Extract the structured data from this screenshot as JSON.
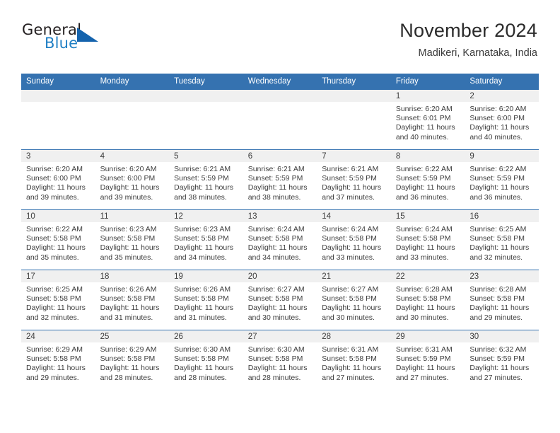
{
  "brand": {
    "name_part1": "General",
    "name_part2": "Blue",
    "triangle_color": "#1463ad",
    "blue_color": "#1f7fc4"
  },
  "header": {
    "title": "November 2024",
    "subtitle": "Madikeri, Karnataka, India"
  },
  "theme": {
    "header_blue": "#3572b0",
    "daynum_band": "#f0f0f0",
    "text": "#3c3c3c"
  },
  "weekdays": [
    "Sunday",
    "Monday",
    "Tuesday",
    "Wednesday",
    "Thursday",
    "Friday",
    "Saturday"
  ],
  "labels": {
    "sunrise_prefix": "Sunrise:",
    "sunset_prefix": "Sunset:",
    "daylight_prefix": "Daylight:"
  },
  "weeks": [
    [
      {
        "empty": true
      },
      {
        "empty": true
      },
      {
        "empty": true
      },
      {
        "empty": true
      },
      {
        "empty": true
      },
      {
        "day": "1",
        "sunrise": "Sunrise: 6:20 AM",
        "sunset": "Sunset: 6:01 PM",
        "daylight": "Daylight: 11 hours and 40 minutes."
      },
      {
        "day": "2",
        "sunrise": "Sunrise: 6:20 AM",
        "sunset": "Sunset: 6:00 PM",
        "daylight": "Daylight: 11 hours and 40 minutes."
      }
    ],
    [
      {
        "day": "3",
        "sunrise": "Sunrise: 6:20 AM",
        "sunset": "Sunset: 6:00 PM",
        "daylight": "Daylight: 11 hours and 39 minutes."
      },
      {
        "day": "4",
        "sunrise": "Sunrise: 6:20 AM",
        "sunset": "Sunset: 6:00 PM",
        "daylight": "Daylight: 11 hours and 39 minutes."
      },
      {
        "day": "5",
        "sunrise": "Sunrise: 6:21 AM",
        "sunset": "Sunset: 5:59 PM",
        "daylight": "Daylight: 11 hours and 38 minutes."
      },
      {
        "day": "6",
        "sunrise": "Sunrise: 6:21 AM",
        "sunset": "Sunset: 5:59 PM",
        "daylight": "Daylight: 11 hours and 38 minutes."
      },
      {
        "day": "7",
        "sunrise": "Sunrise: 6:21 AM",
        "sunset": "Sunset: 5:59 PM",
        "daylight": "Daylight: 11 hours and 37 minutes."
      },
      {
        "day": "8",
        "sunrise": "Sunrise: 6:22 AM",
        "sunset": "Sunset: 5:59 PM",
        "daylight": "Daylight: 11 hours and 36 minutes."
      },
      {
        "day": "9",
        "sunrise": "Sunrise: 6:22 AM",
        "sunset": "Sunset: 5:59 PM",
        "daylight": "Daylight: 11 hours and 36 minutes."
      }
    ],
    [
      {
        "day": "10",
        "sunrise": "Sunrise: 6:22 AM",
        "sunset": "Sunset: 5:58 PM",
        "daylight": "Daylight: 11 hours and 35 minutes."
      },
      {
        "day": "11",
        "sunrise": "Sunrise: 6:23 AM",
        "sunset": "Sunset: 5:58 PM",
        "daylight": "Daylight: 11 hours and 35 minutes."
      },
      {
        "day": "12",
        "sunrise": "Sunrise: 6:23 AM",
        "sunset": "Sunset: 5:58 PM",
        "daylight": "Daylight: 11 hours and 34 minutes."
      },
      {
        "day": "13",
        "sunrise": "Sunrise: 6:24 AM",
        "sunset": "Sunset: 5:58 PM",
        "daylight": "Daylight: 11 hours and 34 minutes."
      },
      {
        "day": "14",
        "sunrise": "Sunrise: 6:24 AM",
        "sunset": "Sunset: 5:58 PM",
        "daylight": "Daylight: 11 hours and 33 minutes."
      },
      {
        "day": "15",
        "sunrise": "Sunrise: 6:24 AM",
        "sunset": "Sunset: 5:58 PM",
        "daylight": "Daylight: 11 hours and 33 minutes."
      },
      {
        "day": "16",
        "sunrise": "Sunrise: 6:25 AM",
        "sunset": "Sunset: 5:58 PM",
        "daylight": "Daylight: 11 hours and 32 minutes."
      }
    ],
    [
      {
        "day": "17",
        "sunrise": "Sunrise: 6:25 AM",
        "sunset": "Sunset: 5:58 PM",
        "daylight": "Daylight: 11 hours and 32 minutes."
      },
      {
        "day": "18",
        "sunrise": "Sunrise: 6:26 AM",
        "sunset": "Sunset: 5:58 PM",
        "daylight": "Daylight: 11 hours and 31 minutes."
      },
      {
        "day": "19",
        "sunrise": "Sunrise: 6:26 AM",
        "sunset": "Sunset: 5:58 PM",
        "daylight": "Daylight: 11 hours and 31 minutes."
      },
      {
        "day": "20",
        "sunrise": "Sunrise: 6:27 AM",
        "sunset": "Sunset: 5:58 PM",
        "daylight": "Daylight: 11 hours and 30 minutes."
      },
      {
        "day": "21",
        "sunrise": "Sunrise: 6:27 AM",
        "sunset": "Sunset: 5:58 PM",
        "daylight": "Daylight: 11 hours and 30 minutes."
      },
      {
        "day": "22",
        "sunrise": "Sunrise: 6:28 AM",
        "sunset": "Sunset: 5:58 PM",
        "daylight": "Daylight: 11 hours and 30 minutes."
      },
      {
        "day": "23",
        "sunrise": "Sunrise: 6:28 AM",
        "sunset": "Sunset: 5:58 PM",
        "daylight": "Daylight: 11 hours and 29 minutes."
      }
    ],
    [
      {
        "day": "24",
        "sunrise": "Sunrise: 6:29 AM",
        "sunset": "Sunset: 5:58 PM",
        "daylight": "Daylight: 11 hours and 29 minutes."
      },
      {
        "day": "25",
        "sunrise": "Sunrise: 6:29 AM",
        "sunset": "Sunset: 5:58 PM",
        "daylight": "Daylight: 11 hours and 28 minutes."
      },
      {
        "day": "26",
        "sunrise": "Sunrise: 6:30 AM",
        "sunset": "Sunset: 5:58 PM",
        "daylight": "Daylight: 11 hours and 28 minutes."
      },
      {
        "day": "27",
        "sunrise": "Sunrise: 6:30 AM",
        "sunset": "Sunset: 5:58 PM",
        "daylight": "Daylight: 11 hours and 28 minutes."
      },
      {
        "day": "28",
        "sunrise": "Sunrise: 6:31 AM",
        "sunset": "Sunset: 5:58 PM",
        "daylight": "Daylight: 11 hours and 27 minutes."
      },
      {
        "day": "29",
        "sunrise": "Sunrise: 6:31 AM",
        "sunset": "Sunset: 5:59 PM",
        "daylight": "Daylight: 11 hours and 27 minutes."
      },
      {
        "day": "30",
        "sunrise": "Sunrise: 6:32 AM",
        "sunset": "Sunset: 5:59 PM",
        "daylight": "Daylight: 11 hours and 27 minutes."
      }
    ]
  ]
}
